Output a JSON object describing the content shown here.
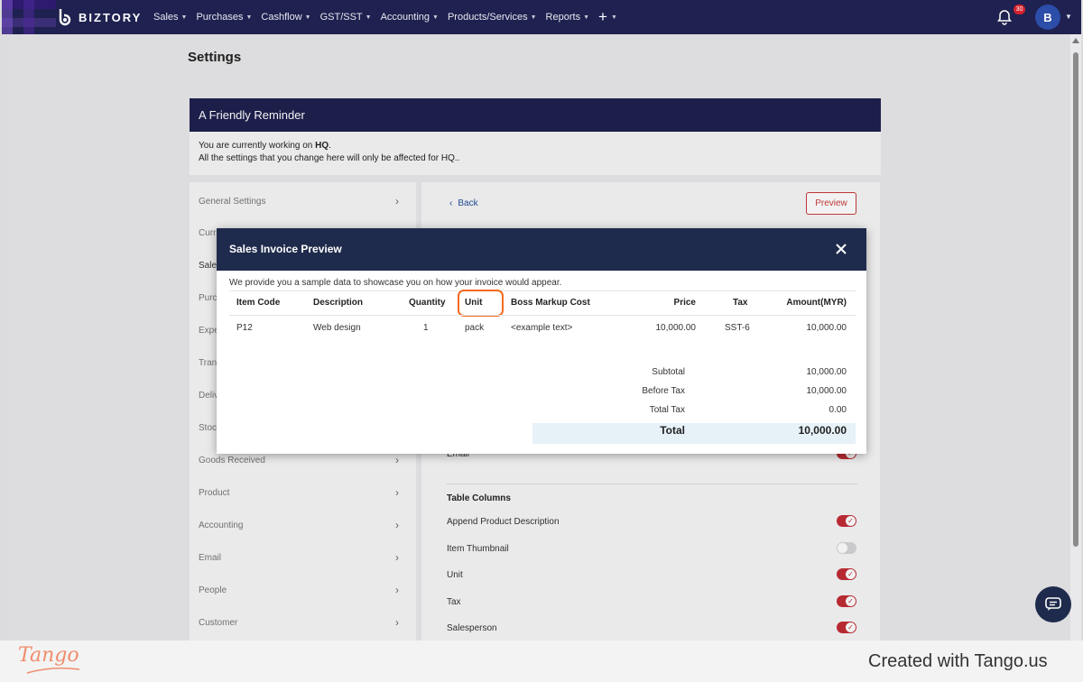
{
  "nav": {
    "brand": "BIZTORY",
    "menu": [
      {
        "label": "Sales"
      },
      {
        "label": "Purchases"
      },
      {
        "label": "Cashflow"
      },
      {
        "label": "GST/SST"
      },
      {
        "label": "Accounting"
      },
      {
        "label": "Products/Services"
      },
      {
        "label": "Reports"
      }
    ],
    "plus": "+",
    "notification_count": "30",
    "avatar_initial": "B"
  },
  "page": {
    "title": "Settings",
    "reminder": {
      "title": "A Friendly Reminder",
      "line1_prefix": "You are currently working on ",
      "branch": "HQ",
      "line1_suffix": ".",
      "line2": "All the settings that you change here will only be affected for HQ.."
    }
  },
  "sidebar": {
    "items": [
      {
        "label": "General Settings"
      },
      {
        "label": "Curr"
      },
      {
        "label": "Sales"
      },
      {
        "label": "Purc"
      },
      {
        "label": "Expe"
      },
      {
        "label": "Tran"
      },
      {
        "label": "Deliv"
      },
      {
        "label": "Stoc"
      },
      {
        "label": "Goods Received"
      },
      {
        "label": "Product"
      },
      {
        "label": "Accounting"
      },
      {
        "label": "Email"
      },
      {
        "label": "People"
      },
      {
        "label": "Customer"
      }
    ]
  },
  "content": {
    "back_label": "Back",
    "preview_label": "Preview",
    "email_label": "Email",
    "table_columns_title": "Table Columns",
    "settings": [
      {
        "label": "Append Product Description",
        "on": true
      },
      {
        "label": "Item Thumbnail",
        "on": false
      },
      {
        "label": "Unit",
        "on": true
      },
      {
        "label": "Tax",
        "on": true
      },
      {
        "label": "Salesperson",
        "on": true
      }
    ]
  },
  "modal": {
    "title": "Sales Invoice Preview",
    "intro": "We provide you a sample data to showcase you on how your invoice would appear.",
    "headers": [
      "Item Code",
      "Description",
      "Quantity",
      "Unit",
      "Boss Markup Cost",
      "Price",
      "Tax",
      "Amount(MYR)"
    ],
    "row": {
      "item_code": "P12",
      "description": "Web design",
      "quantity": "1",
      "unit": "pack",
      "boss_markup_cost": "<example text>",
      "price": "10,000.00",
      "tax": "SST-6",
      "amount": "10,000.00"
    },
    "summary": {
      "subtotal_label": "Subtotal",
      "subtotal": "10,000.00",
      "before_tax_label": "Before Tax",
      "before_tax": "10,000.00",
      "total_tax_label": "Total Tax",
      "total_tax": "0.00",
      "total_label": "Total",
      "total": "10,000.00"
    }
  },
  "footer": {
    "logo": "Tango",
    "created": "Created with Tango.us"
  },
  "colors": {
    "nav_bg": "#1f2150",
    "modal_head_bg": "#1f2b4c",
    "accent_red": "#c22d35",
    "highlight_orange": "#f26a21",
    "tango_orange": "#ef8d6c"
  }
}
